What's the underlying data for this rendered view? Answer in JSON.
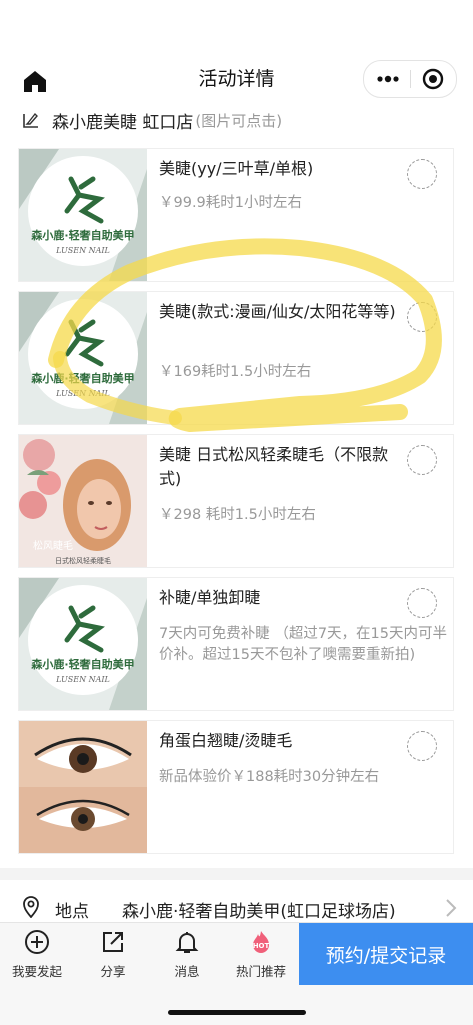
{
  "header": {
    "title": "活动详情"
  },
  "store": {
    "name": "森小鹿美睫 虹口店",
    "hint": "(图片可点击)"
  },
  "items": [
    {
      "title": "美睫(yy/三叶草/单根)",
      "desc": "￥99.9耗时1小时左右",
      "image": "森小鹿·轻奢自助美甲",
      "image_sub": "LUSEN NAIL"
    },
    {
      "title": "美睫(款式:漫画/仙女/太阳花等等)",
      "desc": "￥169耗时1.5小时左右",
      "image": "森小鹿·轻奢自助美甲",
      "image_sub": "LUSEN NAIL"
    },
    {
      "title": "美睫 日式松风轻柔睫毛（不限款式)",
      "desc": "￥298 耗时1.5小时左右",
      "image_tag": "松风睫毛",
      "image_caption": "日式松风轻柔睫毛"
    },
    {
      "title": "补睫/单独卸睫",
      "desc": "7天内可免费补睫 （超过7天，在15天内可半价补。超过15天不包补了噢需要重新拍)",
      "image": "森小鹿·轻奢自助美甲",
      "image_sub": "LUSEN NAIL"
    },
    {
      "title": "角蛋白翘睫/烫睫毛",
      "desc": "新品体验价￥188耗时30分钟左右"
    }
  ],
  "location": {
    "label": "地点",
    "value": "森小鹿·轻奢自助美甲(虹口足球场店)"
  },
  "tabbar": {
    "tabs": [
      {
        "label": "我要发起",
        "icon": "plus-circle-icon"
      },
      {
        "label": "分享",
        "icon": "share-icon"
      },
      {
        "label": "消息",
        "icon": "bell-icon"
      },
      {
        "label": "热门推荐",
        "icon": "hot-flame-icon"
      }
    ],
    "cta": "预约/提交记录"
  },
  "colors": {
    "accent": "#3d8ef0",
    "highlight": "#f5d94a",
    "brand_green": "#2e6b3c"
  }
}
